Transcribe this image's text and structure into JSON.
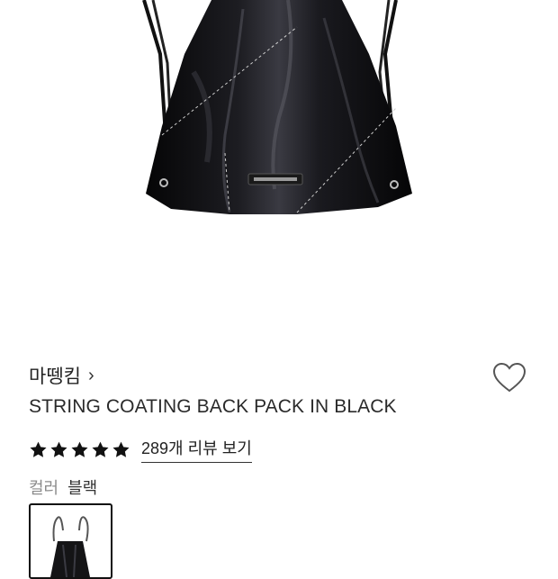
{
  "product": {
    "brand": "마뗑킴",
    "brand_chevron": "›",
    "title": "STRING COATING BACK PACK IN BLACK",
    "rating": 5,
    "reviews_link": "289개 리뷰 보기"
  },
  "options": {
    "label": "컬러",
    "selected_value": "블랙"
  },
  "icons": {
    "wishlist": "heart-outline-icon",
    "star": "star-filled-icon",
    "brand_link": "chevron-right-icon"
  },
  "colors": {
    "bag": "#0b0b0d",
    "star": "#111111",
    "swatch_border": "#111111"
  }
}
